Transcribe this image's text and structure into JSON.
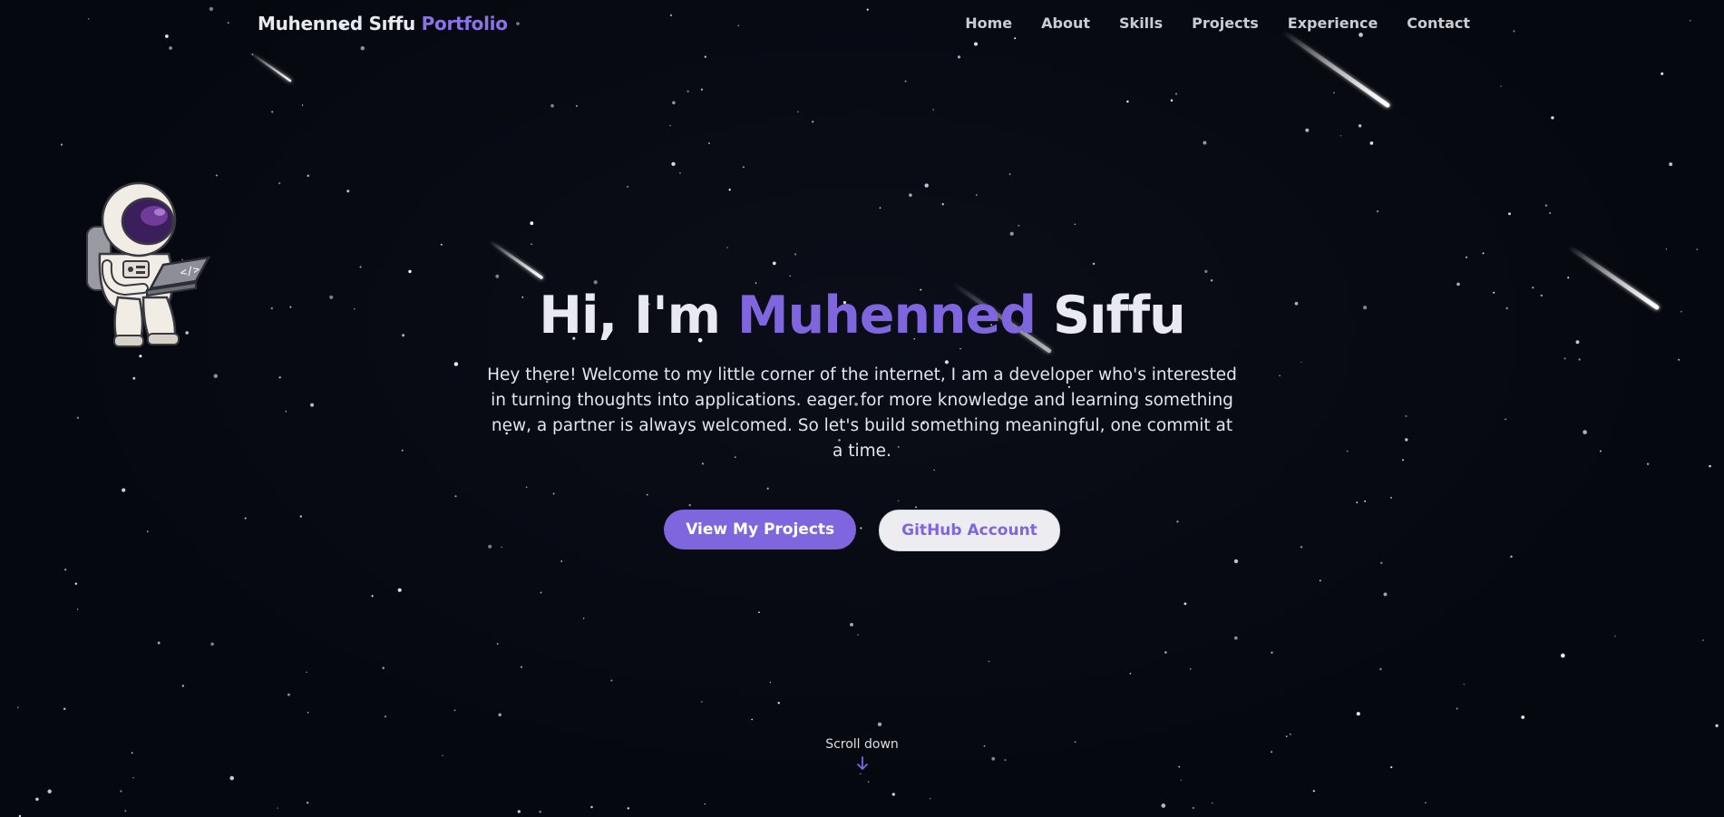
{
  "brand": {
    "name": "Muhenned Sıffu",
    "accent": "Portfolio"
  },
  "nav": {
    "items": [
      {
        "label": "Home"
      },
      {
        "label": "About"
      },
      {
        "label": "Skills"
      },
      {
        "label": "Projects"
      },
      {
        "label": "Experience"
      },
      {
        "label": "Contact"
      }
    ]
  },
  "hero": {
    "greeting": "Hi, I'm",
    "first_name": "Muhenned",
    "last_name": "Sıffu",
    "intro": "Hey there! Welcome to my little corner of the internet, I am a developer who's interested in turning thoughts into applications. eager for more knowledge and learning something new, a partner is always welcomed. So let's build something meaningful, one commit at a time.",
    "primary_button": "View My Projects",
    "secondary_button": "GitHub Account"
  },
  "scroll": {
    "label": "Scroll down",
    "icon": "arrow-down-icon"
  },
  "decor": {
    "illustration": "astronaut-with-laptop",
    "background": "starfield-with-shooting-stars"
  },
  "colors": {
    "background": "#06080f",
    "accent": "#7f66df",
    "text": "#e8e9f1"
  }
}
